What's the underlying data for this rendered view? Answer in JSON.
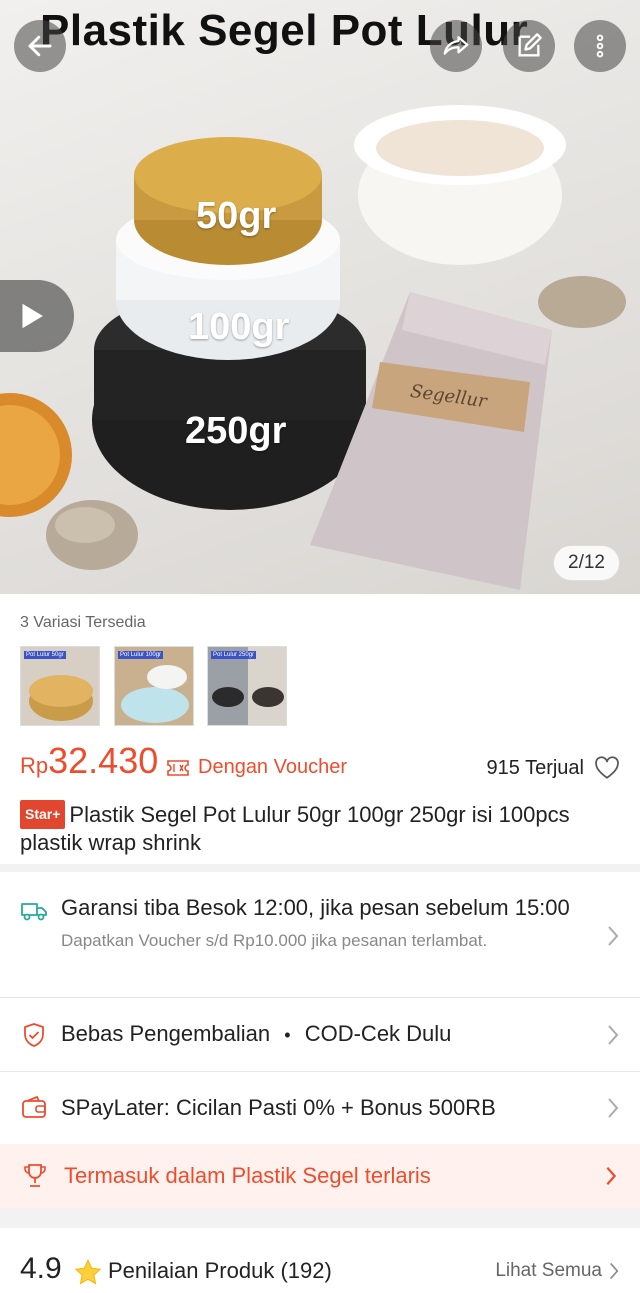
{
  "hero": {
    "title": "Plastik Segel Pot Lulur",
    "pot_labels": [
      "50gr",
      "100gr",
      "250gr"
    ],
    "band_text": "Segellur",
    "counter": "2/12"
  },
  "icons": {
    "back": "arrow-left-icon",
    "share": "share-icon",
    "edit": "edit-icon",
    "more": "more-vertical-icon",
    "play": "play-icon"
  },
  "variants": {
    "label": "3 Variasi Tersedia",
    "thumbs": [
      {
        "tag": "Pot Lulur 50gr",
        "color": "#c89c49"
      },
      {
        "tag": "Pot Lulur 100gr",
        "color": "#e9eef0"
      },
      {
        "tag": "Pot Lulur 250gr",
        "color": "#2b2b2b"
      }
    ]
  },
  "price": {
    "currency": "Rp",
    "amount": "32.430",
    "voucher": "Dengan Voucher",
    "sold": "915 Terjual"
  },
  "product": {
    "badge": "Star+",
    "title": "Plastik Segel Pot Lulur 50gr 100gr 250gr isi 100pcs plastik wrap shrink"
  },
  "rows": {
    "shipping": {
      "title": "Garansi tiba Besok 12:00, jika pesan sebelum 15:00",
      "sub": "Dapatkan Voucher s/d Rp10.000 jika pesanan terlambat."
    },
    "returns": {
      "label": "Bebas Pengembalian",
      "dot": "•",
      "cod": "COD-Cek Dulu"
    },
    "paylater": {
      "label": "SPayLater: Cicilan Pasti 0% + Bonus 500RB"
    },
    "bestseller": {
      "label": "Termasuk dalam Plastik Segel terlaris"
    }
  },
  "rating": {
    "value": "4.9",
    "title": "Penilaian Produk",
    "count": "(192)",
    "see_all": "Lihat Semua"
  },
  "colors": {
    "accent": "#ee4d2d",
    "highlight_bg": "#fff2ee",
    "teal": "#26aa99",
    "star": "#ffce3d"
  }
}
